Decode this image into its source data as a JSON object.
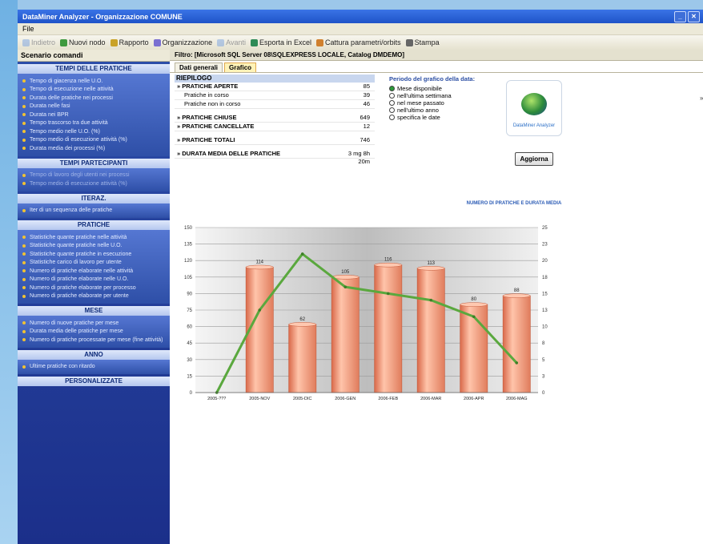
{
  "window": {
    "title": "DataMiner Analyzer - Organizzazione COMUNE"
  },
  "menu": {
    "file": "File"
  },
  "toolbar": {
    "items": [
      {
        "label": "Indietro",
        "icon": "back-arrow-icon",
        "dim": true
      },
      {
        "label": "Nuovi nodo",
        "icon": "new-node-icon",
        "dim": false
      },
      {
        "label": "Rapporto",
        "icon": "report-icon",
        "dim": false
      },
      {
        "label": "Organizzazione",
        "icon": "organization-icon",
        "dim": false
      },
      {
        "label": "Avanti",
        "icon": "forward-arrow-icon",
        "dim": true
      },
      {
        "label": "Esporta in Excel",
        "icon": "excel-icon",
        "dim": false
      },
      {
        "label": "Cattura parametri/orbits",
        "icon": "capture-icon",
        "dim": false
      },
      {
        "label": "Stampa",
        "icon": "print-icon",
        "dim": false
      }
    ]
  },
  "sidebar": {
    "title": "Scenario comandi",
    "sections": [
      {
        "title": "TEMPI DELLE PRATICHE",
        "items": [
          {
            "label": "Tempo di giacenza nelle U.O.",
            "dim": false
          },
          {
            "label": "Tempo di esecuzione nelle attività",
            "dim": false
          },
          {
            "label": "Durata delle pratiche nei processi",
            "dim": false
          },
          {
            "label": "Durata nelle fasi",
            "dim": false
          },
          {
            "label": "Durata nei BPR",
            "dim": false
          },
          {
            "label": "Tempo trascorso tra due attività",
            "dim": false
          },
          {
            "label": "Tempo medio nelle U.O. (%)",
            "dim": false
          },
          {
            "label": "Tempo medio di esecuzione attività (%)",
            "dim": false
          },
          {
            "label": "Durata media dei processi (%)",
            "dim": false
          }
        ]
      },
      {
        "title": "TEMPI PARTECIPANTI",
        "items": [
          {
            "label": "Tempo di lavoro degli utenti nei processi",
            "dim": true
          },
          {
            "label": "Tempo medio di esecuzione attività (%)",
            "dim": true
          }
        ]
      },
      {
        "title": "ITERAZ.",
        "items": [
          {
            "label": "Iter di un sequenza delle pratiche",
            "dim": false
          }
        ]
      },
      {
        "title": "PRATICHE",
        "items": [
          {
            "label": "Statistiche quante pratiche nelle attività",
            "dim": false
          },
          {
            "label": "Statistiche quante pratiche nelle U.O.",
            "dim": false
          },
          {
            "label": "Statistiche quante pratiche in esecuzione",
            "dim": false
          },
          {
            "label": "Statistiche carico di lavoro per utente",
            "dim": false
          },
          {
            "label": "Numero di pratiche elaborate nelle attività",
            "dim": false
          },
          {
            "label": "Numero di pratiche elaborate nelle U.O.",
            "dim": false
          },
          {
            "label": "Numero di pratiche elaborate per processo",
            "dim": false
          },
          {
            "label": "Numero di pratiche elaborate per utente",
            "dim": false
          }
        ]
      },
      {
        "title": "MESE",
        "items": [
          {
            "label": "Numero di nuove pratiche per mese",
            "dim": false
          },
          {
            "label": "Durata media delle pratiche per mese",
            "dim": false
          },
          {
            "label": "Numero di pratiche processate per mese (fine attività)",
            "dim": false
          }
        ]
      },
      {
        "title": "ANNO",
        "items": [
          {
            "label": "Ultime pratiche con ritardo",
            "dim": false
          }
        ]
      },
      {
        "title": "PERSONALIZZATE",
        "items": []
      }
    ]
  },
  "filter": {
    "text": "Filtro: [Microsoft SQL Server 08\\SQLEXPRESS LOCALE, Catalog DMDEMO]"
  },
  "tabs": [
    {
      "label": "Dati generali",
      "active": false
    },
    {
      "label": "Grafico",
      "active": true
    }
  ],
  "summary": {
    "header": "RIEPILOGO",
    "rows": [
      {
        "label": "PRATICHE APERTE",
        "value": "85",
        "bold": true,
        "sub": false,
        "gap_before": false
      },
      {
        "label": "Pratiche in corso",
        "value": "39",
        "bold": false,
        "sub": true,
        "gap_before": false
      },
      {
        "label": "Pratiche non in corso",
        "value": "46",
        "bold": false,
        "sub": true,
        "gap_before": false
      },
      {
        "label": "PRATICHE CHIUSE",
        "value": "649",
        "bold": true,
        "sub": false,
        "gap_before": true
      },
      {
        "label": "PRATICHE CANCELLATE",
        "value": "12",
        "bold": true,
        "sub": false,
        "gap_before": false
      },
      {
        "label": "PRATICHE TOTALI",
        "value": "746",
        "bold": true,
        "sub": false,
        "gap_before": true
      },
      {
        "label": "DURATA MEDIA DELLE PRATICHE",
        "value": "3 mg 8h 20m",
        "bold": true,
        "sub": false,
        "gap_before": true
      }
    ]
  },
  "period": {
    "title": "Periodo del grafico della data:",
    "options": [
      {
        "label": "Mese disponibile",
        "selected": true
      },
      {
        "label": "nell'ultima settimana",
        "selected": false
      },
      {
        "label": "nel mese passato",
        "selected": false
      },
      {
        "label": "nell'ultimo anno",
        "selected": false
      },
      {
        "label": "specifica le date",
        "selected": false
      }
    ]
  },
  "logo": {
    "text": "DataMiner Analyzer",
    "icon": "dataminer-logo-icon"
  },
  "update_button": {
    "label": "Aggiorna"
  },
  "chart_data": {
    "type": "bar",
    "title": "NUMERO DI PRATICHE E DURATA MEDIA",
    "categories": [
      "2005-???",
      "2005-NOV",
      "2005-DIC",
      "2006-GEN",
      "2006-FEB",
      "2006-MAR",
      "2006-APR",
      "2006-MAG"
    ],
    "series": [
      {
        "name": "Numero pratiche",
        "type": "bar",
        "axis": "left",
        "values": [
          0,
          114,
          62,
          105,
          116,
          113,
          80,
          88
        ],
        "color": "#f29a7c"
      },
      {
        "name": "Durata media",
        "type": "line",
        "axis": "right",
        "values": [
          0,
          12.5,
          21,
          16,
          15,
          14,
          11.5,
          4.5
        ],
        "color": "#5aa83e"
      }
    ],
    "data_labels": [
      "",
      "114",
      "62",
      "105",
      "116",
      "113",
      "80",
      "88"
    ],
    "y_left": {
      "ticks": [
        "0",
        "15",
        "30",
        "45",
        "60",
        "75",
        "90",
        "105",
        "120",
        "135",
        "150"
      ],
      "min": 0,
      "max": 150
    },
    "y_right": {
      "ticks": [
        "0",
        "3",
        "5",
        "8",
        "10",
        "13",
        "15",
        "18",
        "20",
        "23",
        "25"
      ],
      "min": 0,
      "max": 25
    },
    "grid": true
  }
}
